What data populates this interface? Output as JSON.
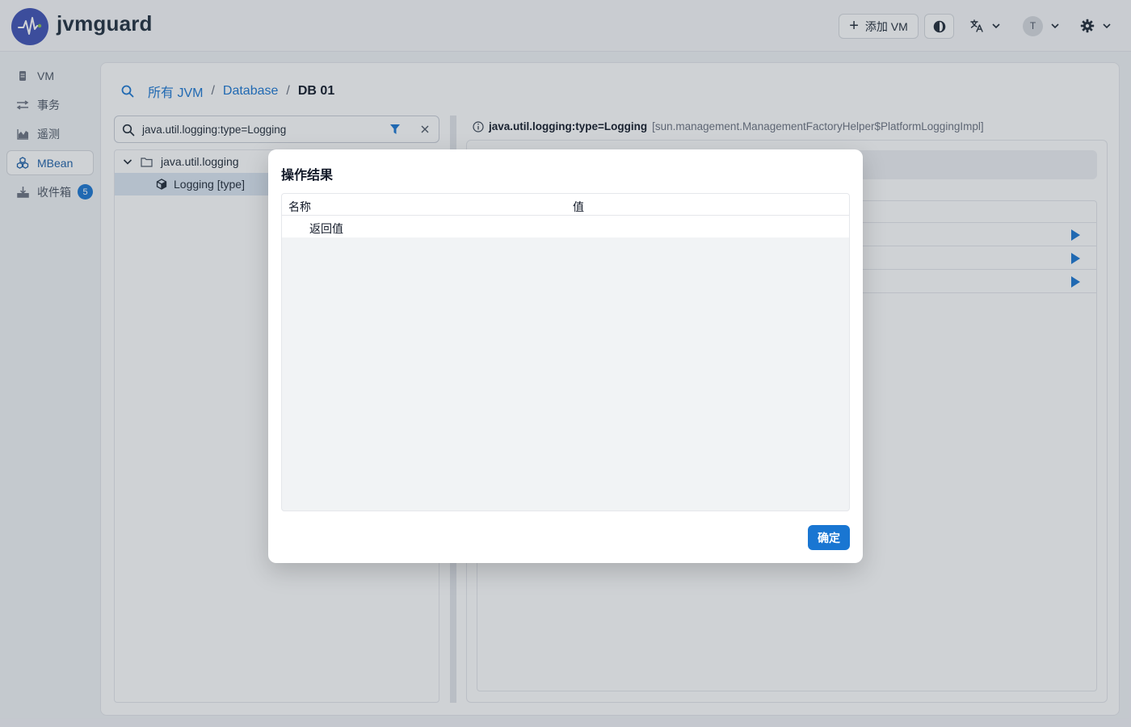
{
  "header": {
    "app_title": "jvmguard",
    "add_vm_label": "添加 VM",
    "avatar_initial": "T",
    "icons": [
      "pulse-logo-icon",
      "plus-icon",
      "theme-contrast-icon",
      "translate-icon",
      "chevron-down-icon",
      "gear-icon"
    ],
    "accent_color": "#3f51b5"
  },
  "sidebar": {
    "items": [
      {
        "label": "VM",
        "icon": "server-icon"
      },
      {
        "label": "事务",
        "icon": "transactions-icon"
      },
      {
        "label": "遥测",
        "icon": "telemetry-chart-icon"
      },
      {
        "label": "MBean",
        "icon": "mbean-cubes-icon",
        "active": true
      },
      {
        "label": "收件箱",
        "icon": "inbox-icon",
        "badge": "5"
      }
    ]
  },
  "breadcrumb": {
    "items": [
      "所有 JVM",
      "Database"
    ],
    "separator": "/",
    "current": "DB 01"
  },
  "search": {
    "value": "java.util.logging:type=Logging"
  },
  "tree": {
    "folder": "java.util.logging",
    "leaf": "Logging [type]"
  },
  "detail": {
    "object_name": "java.util.logging:type=Logging",
    "class_name": "[sun.management.ManagementFactoryHelper$PlatformLoggingImpl]",
    "operation_count": 3
  },
  "dialog": {
    "title": "操作结果",
    "columns": [
      "名称",
      "值"
    ],
    "rows": [
      {
        "name": "返回值",
        "value": ""
      }
    ],
    "ok_label": "确定"
  },
  "colors": {
    "primary": "#1976d2",
    "active_nav_text": "#1c5fa8",
    "selected_row": "#dce6f2"
  }
}
